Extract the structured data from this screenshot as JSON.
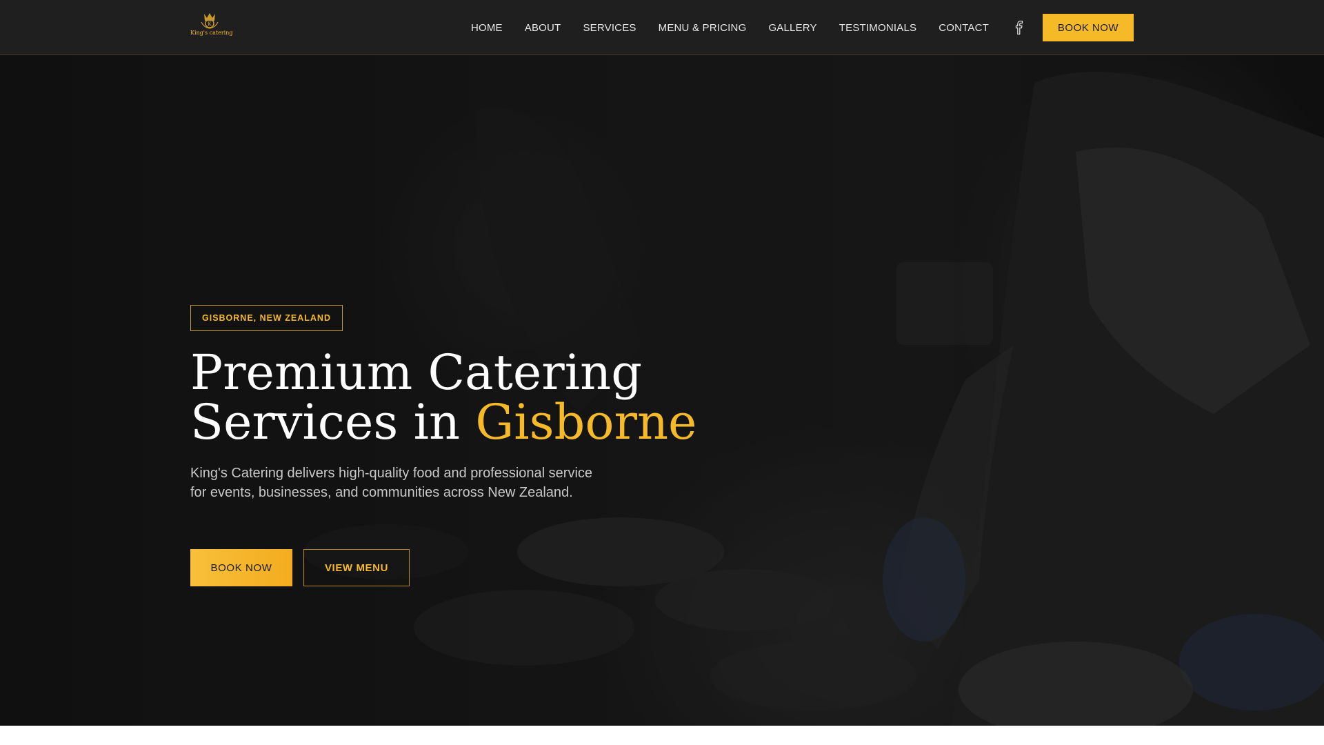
{
  "nav": {
    "logo_text": "King's catering",
    "items": [
      {
        "label": "HOME"
      },
      {
        "label": "ABOUT"
      },
      {
        "label": "SERVICES"
      },
      {
        "label": "MENU & PRICING"
      },
      {
        "label": "GALLERY"
      },
      {
        "label": "TESTIMONIALS"
      },
      {
        "label": "CONTACT"
      }
    ],
    "social_icon": "facebook-icon",
    "cta_label": "BOOK NOW"
  },
  "hero": {
    "badge": "GISBORNE, NEW ZEALAND",
    "headline_line1": "Premium Catering",
    "headline_line2_prefix": "Services in ",
    "headline_line2_accent": "Gisborne",
    "description": "King's Catering delivers high-quality food and professional service for events, businesses, and communities across New Zealand.",
    "primary_button": "BOOK NOW",
    "secondary_button": "VIEW MENU"
  },
  "colors": {
    "accent": "#f6b928",
    "nav_background": "#1f1f1f",
    "hero_background": "#1b1b1b"
  }
}
